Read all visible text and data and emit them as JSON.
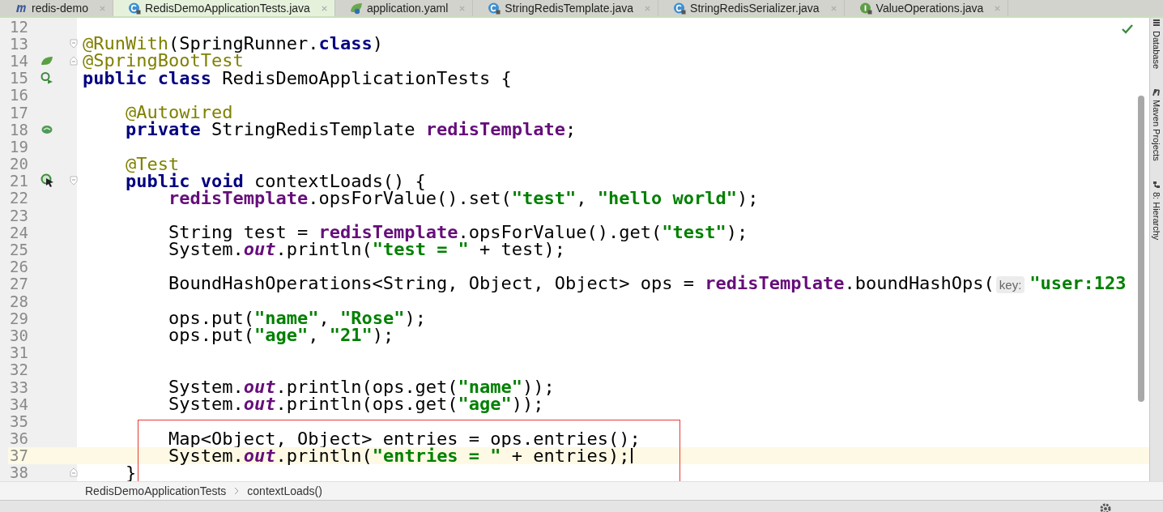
{
  "tabs": [
    {
      "label": "redis-demo",
      "kind": "module",
      "selected": false
    },
    {
      "label": "RedisDemoApplicationTests.java",
      "kind": "class",
      "selected": true
    },
    {
      "label": "application.yaml",
      "kind": "yaml",
      "selected": false
    },
    {
      "label": "StringRedisTemplate.java",
      "kind": "class",
      "selected": false
    },
    {
      "label": "StringRedisSerializer.java",
      "kind": "class",
      "selected": false
    },
    {
      "label": "ValueOperations.java",
      "kind": "interface",
      "selected": false
    }
  ],
  "lines": [
    {
      "number": "12"
    },
    {
      "number": "13",
      "fold_marker": {
        "kind": "start"
      },
      "tokens": [
        {
          "kind": "ann",
          "text": "@RunWith"
        },
        {
          "kind": "plain",
          "text": "(SpringRunner."
        },
        {
          "kind": "kw",
          "text": "class"
        },
        {
          "kind": "plain",
          "text": ")"
        }
      ]
    },
    {
      "number": "14",
      "gutter_icon": {
        "kind": "leaf"
      },
      "fold_marker": {
        "kind": "end"
      },
      "tokens": [
        {
          "kind": "ann",
          "text": "@SpringBootTest"
        }
      ]
    },
    {
      "number": "15",
      "gutter_icon": {
        "kind": "run"
      },
      "tokens": [
        {
          "kind": "kw",
          "text": "public class"
        },
        {
          "kind": "plain",
          "text": " RedisDemoApplicationTests {"
        }
      ]
    },
    {
      "number": "16"
    },
    {
      "number": "17",
      "tokens": [
        {
          "kind": "ann",
          "text": "    @Autowired"
        }
      ]
    },
    {
      "number": "18",
      "gutter_icon": {
        "kind": "bean"
      },
      "tokens": [
        {
          "kind": "kw",
          "text": "    private"
        },
        {
          "kind": "plain",
          "text": " StringRedisTemplate "
        },
        {
          "kind": "field",
          "text": "redisTemplate"
        },
        {
          "kind": "plain",
          "text": ";"
        }
      ]
    },
    {
      "number": "19"
    },
    {
      "number": "20",
      "tokens": [
        {
          "kind": "ann",
          "text": "    @Test"
        }
      ]
    },
    {
      "number": "21",
      "gutter_icon": {
        "kind": "run-test"
      },
      "fold_marker": {
        "kind": "start"
      },
      "tokens": [
        {
          "kind": "kw",
          "text": "    public void"
        },
        {
          "kind": "plain",
          "text": " contextLoads() {"
        }
      ]
    },
    {
      "number": "22",
      "tokens": [
        {
          "kind": "field",
          "text": "        redisTemplate"
        },
        {
          "kind": "plain",
          "text": ".opsForValue().set("
        },
        {
          "kind": "str",
          "text": "\"test\""
        },
        {
          "kind": "plain",
          "text": ", "
        },
        {
          "kind": "str",
          "text": "\"hello world\""
        },
        {
          "kind": "plain",
          "text": ");"
        }
      ]
    },
    {
      "number": "23"
    },
    {
      "number": "24",
      "tokens": [
        {
          "kind": "plain",
          "text": "        String test = "
        },
        {
          "kind": "field",
          "text": "redisTemplate"
        },
        {
          "kind": "plain",
          "text": ".opsForValue().get("
        },
        {
          "kind": "str",
          "text": "\"test\""
        },
        {
          "kind": "plain",
          "text": ");"
        }
      ]
    },
    {
      "number": "25",
      "tokens": [
        {
          "kind": "plain",
          "text": "        System."
        },
        {
          "kind": "static",
          "text": "out"
        },
        {
          "kind": "plain",
          "text": ".println("
        },
        {
          "kind": "str",
          "text": "\"test = \""
        },
        {
          "kind": "plain",
          "text": " + test);"
        }
      ]
    },
    {
      "number": "26"
    },
    {
      "number": "27",
      "tokens": [
        {
          "kind": "plain",
          "text": "        BoundHashOperations<String, Object, Object> ops = "
        },
        {
          "kind": "field",
          "text": "redisTemplate"
        },
        {
          "kind": "plain",
          "text": ".boundHashOps("
        },
        {
          "kind": "hint",
          "text": "key:"
        },
        {
          "kind": "str",
          "text": "\"user:123"
        }
      ]
    },
    {
      "number": "28"
    },
    {
      "number": "29",
      "tokens": [
        {
          "kind": "plain",
          "text": "        ops.put("
        },
        {
          "kind": "str",
          "text": "\"name\""
        },
        {
          "kind": "plain",
          "text": ", "
        },
        {
          "kind": "str",
          "text": "\"Rose\""
        },
        {
          "kind": "plain",
          "text": ");"
        }
      ]
    },
    {
      "number": "30",
      "tokens": [
        {
          "kind": "plain",
          "text": "        ops.put("
        },
        {
          "kind": "str",
          "text": "\"age\""
        },
        {
          "kind": "plain",
          "text": ", "
        },
        {
          "kind": "str",
          "text": "\"21\""
        },
        {
          "kind": "plain",
          "text": ");"
        }
      ]
    },
    {
      "number": "31"
    },
    {
      "number": "32"
    },
    {
      "number": "33",
      "tokens": [
        {
          "kind": "plain",
          "text": "        System."
        },
        {
          "kind": "static",
          "text": "out"
        },
        {
          "kind": "plain",
          "text": ".println(ops.get("
        },
        {
          "kind": "str",
          "text": "\"name\""
        },
        {
          "kind": "plain",
          "text": "));"
        }
      ]
    },
    {
      "number": "34",
      "tokens": [
        {
          "kind": "plain",
          "text": "        System."
        },
        {
          "kind": "static",
          "text": "out"
        },
        {
          "kind": "plain",
          "text": ".println(ops.get("
        },
        {
          "kind": "str",
          "text": "\"age\""
        },
        {
          "kind": "plain",
          "text": "));"
        }
      ]
    },
    {
      "number": "35"
    },
    {
      "number": "36",
      "tokens": [
        {
          "kind": "plain",
          "text": "        Map<Object, Object> entries = ops.entries();"
        }
      ]
    },
    {
      "number": "37",
      "current": true,
      "tokens": [
        {
          "kind": "plain",
          "text": "        System."
        },
        {
          "kind": "static",
          "text": "out"
        },
        {
          "kind": "plain",
          "text": ".println("
        },
        {
          "kind": "str",
          "text": "\"entries = \""
        },
        {
          "kind": "plain",
          "text": " + entries);"
        }
      ]
    },
    {
      "number": "38",
      "fold_marker": {
        "kind": "end"
      },
      "tokens": [
        {
          "kind": "plain",
          "text": "    }"
        }
      ]
    }
  ],
  "annotation": {
    "kind": "rectangle",
    "color": "#e53935"
  },
  "breadcrumb": [
    "RedisDemoApplicationTests",
    "contextLoads()"
  ],
  "tool_windows": [
    {
      "label": "Database",
      "kind": "database"
    },
    {
      "label": "Maven Projects",
      "kind": "maven"
    },
    {
      "label": "8: Hierarchy",
      "kind": "hierarchy"
    }
  ]
}
